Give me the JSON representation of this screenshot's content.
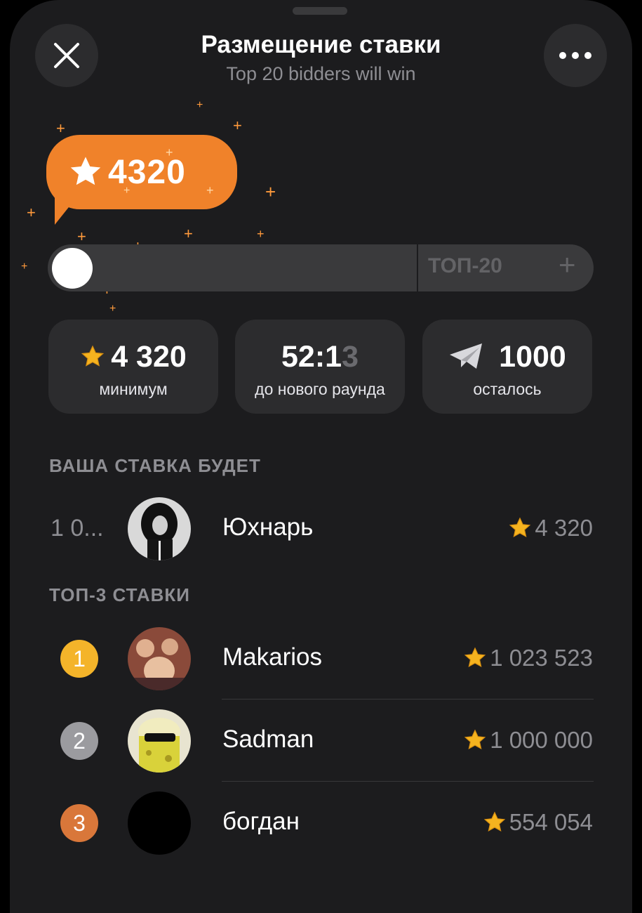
{
  "header": {
    "title": "Размещение ставки",
    "subtitle": "Top 20 bidders will win"
  },
  "bid_bubble": {
    "value": "4320"
  },
  "slider": {
    "label": "ТОП-20",
    "plus": "+",
    "position": 0
  },
  "stats": [
    {
      "icon": "star-icon",
      "value": "4 320",
      "label": "минимум"
    },
    {
      "value_main": "52:1",
      "value_fade": "3",
      "label": "до нового раунда"
    },
    {
      "icon": "telegram-gift-icon",
      "value": "1000",
      "label": "осталось"
    }
  ],
  "your_bid": {
    "section_title": "ВАША СТАВКА БУДЕТ",
    "rank": "1 0...",
    "name": "Юхнарь",
    "amount": "4 320"
  },
  "top3": {
    "section_title": "ТОП-3 СТАВКИ",
    "rows": [
      {
        "rank": "1",
        "name": "Makarios",
        "amount": "1 023 523",
        "medal_color": "#f4b42a"
      },
      {
        "rank": "2",
        "name": "Sadman",
        "amount": "1 000 000",
        "medal_color": "#9b9b9f"
      },
      {
        "rank": "3",
        "name": "богдан",
        "amount": "554 054",
        "medal_color": "#d9773a"
      }
    ]
  },
  "colors": {
    "accent": "#f0822a",
    "star": "#f5b31f",
    "sheet": "#1c1c1e"
  }
}
